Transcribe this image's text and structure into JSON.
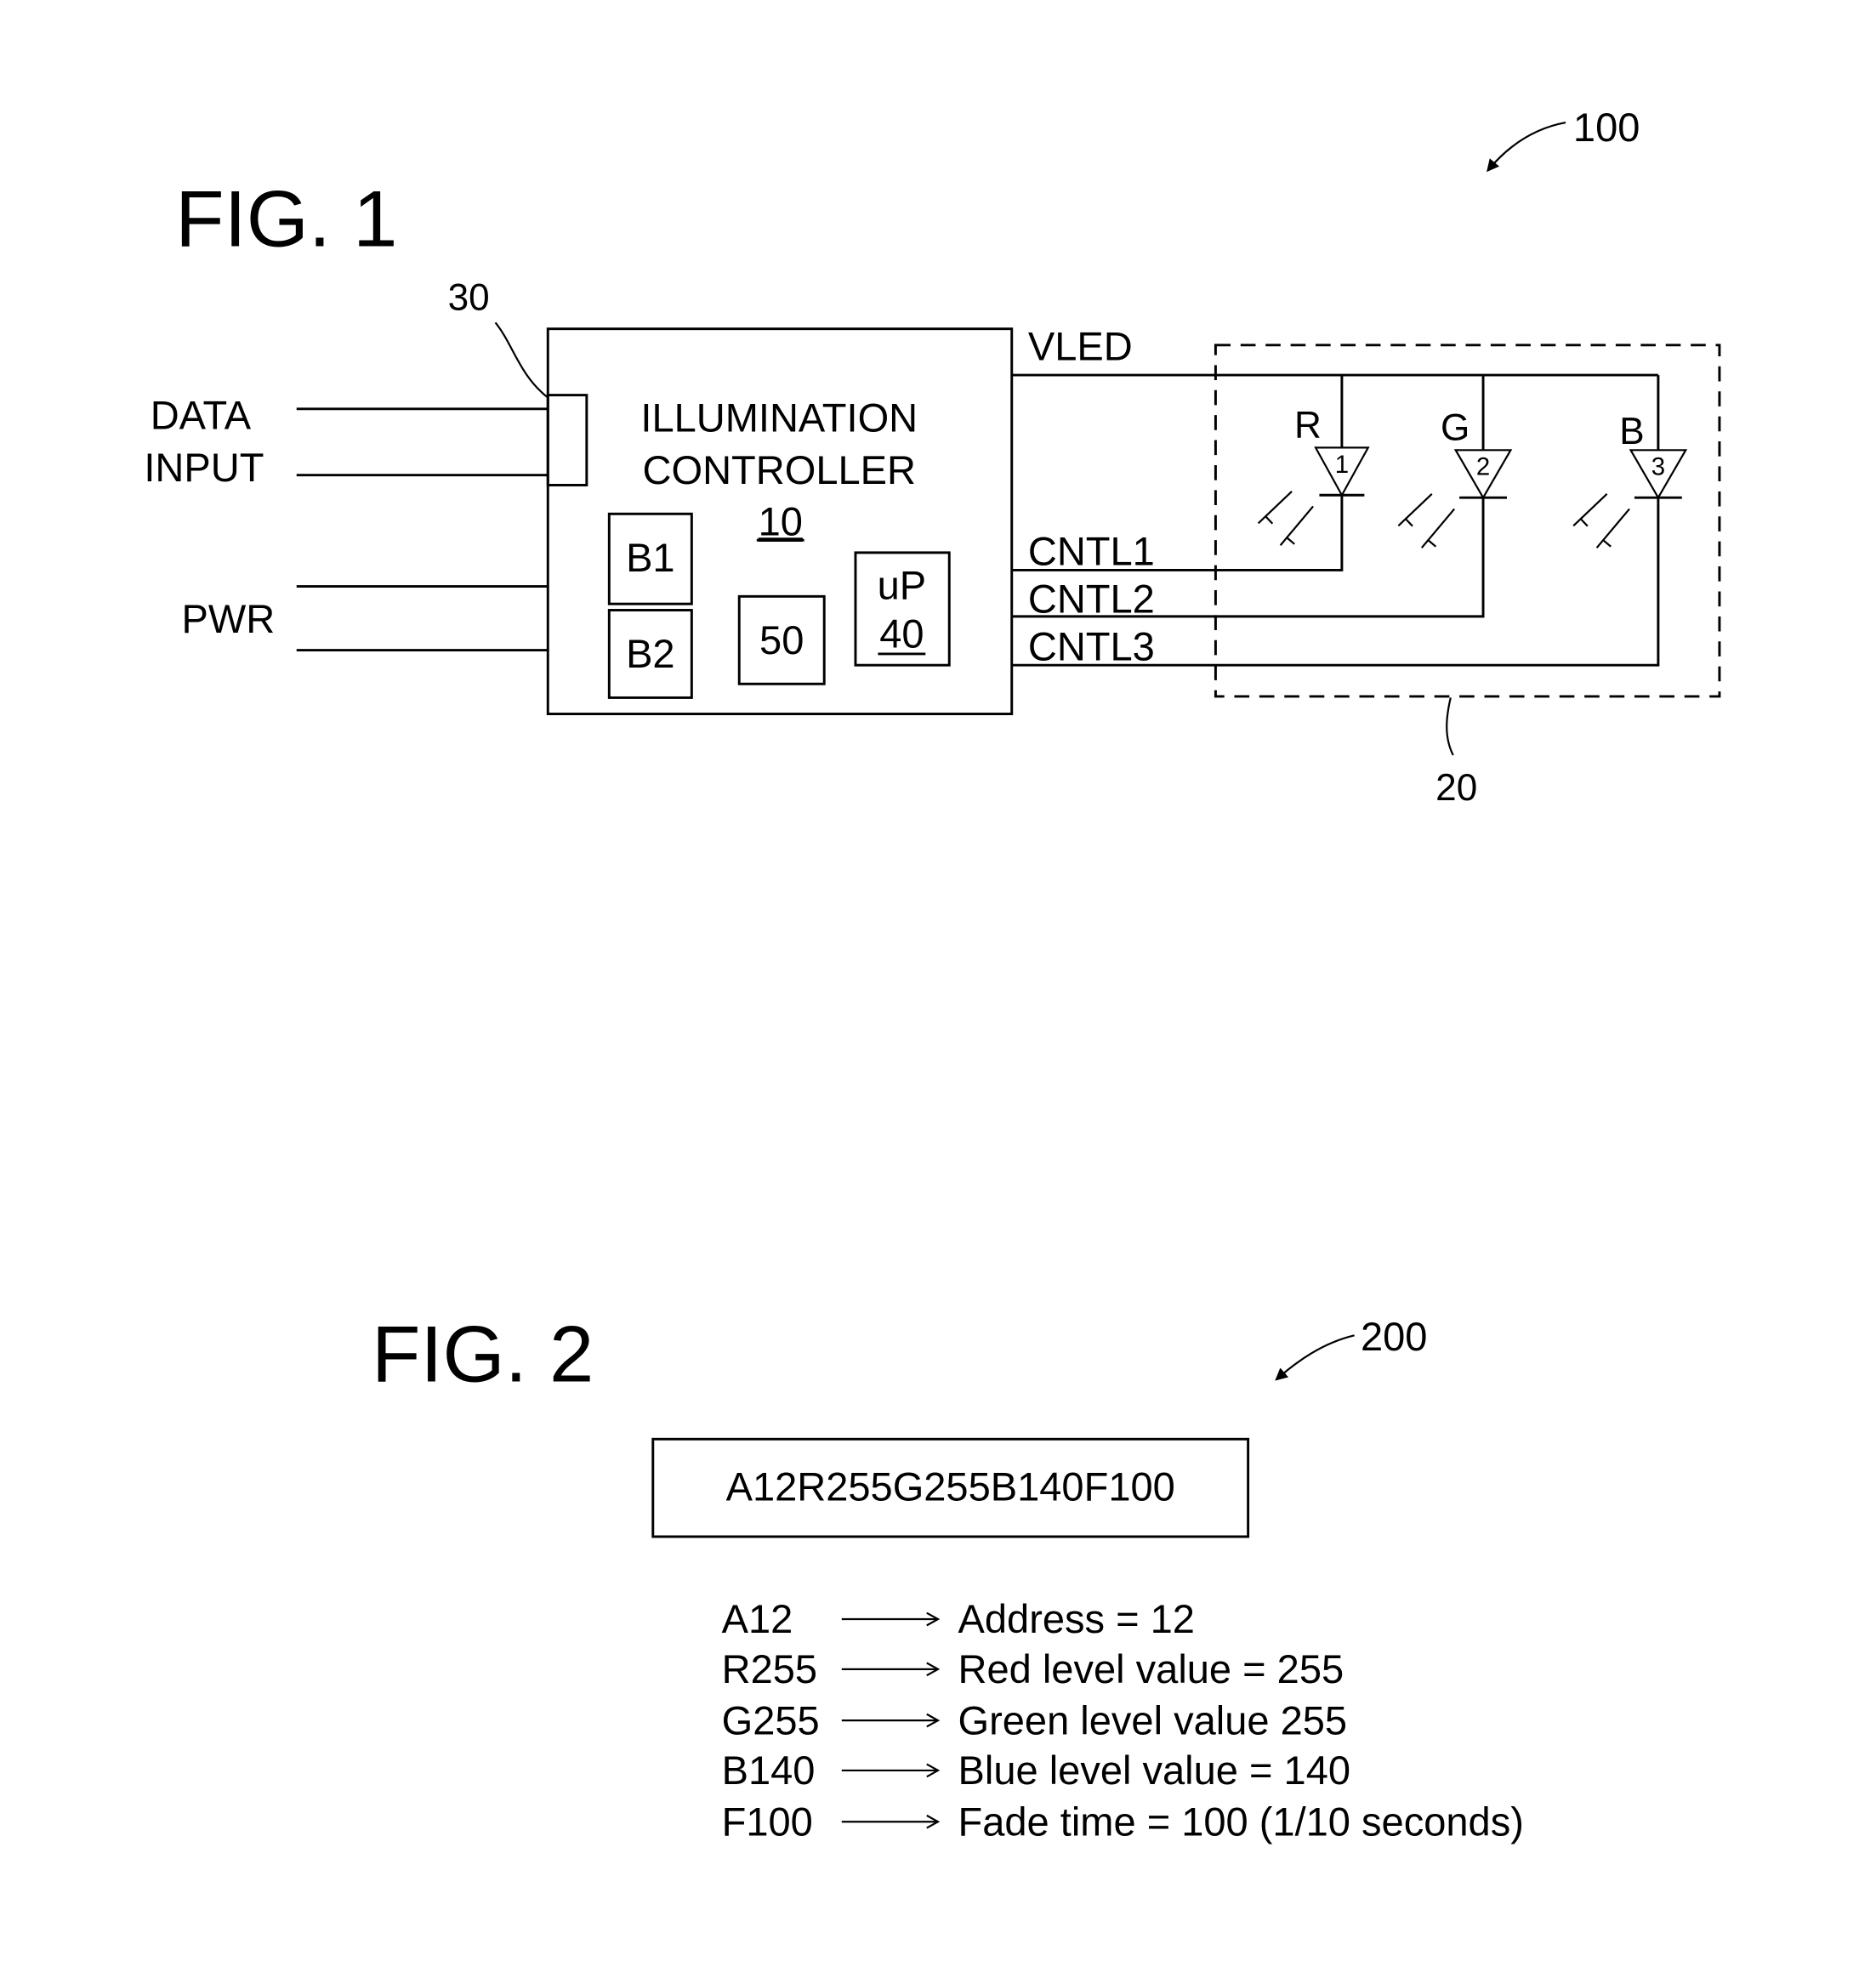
{
  "fig1": {
    "title": "FIG. 1",
    "ref_system": "100",
    "ref_connector": "30",
    "ref_led_group": "20",
    "inputs": {
      "data_line1": "DATA",
      "data_line2": "INPUT",
      "power": "PWR"
    },
    "controller": {
      "line1": "ILLUMINATION",
      "line2": "CONTROLLER",
      "ref": "10",
      "blocks": {
        "b1": "B1",
        "b2": "B2",
        "block50": "50",
        "up_label": "uP",
        "up_ref": "40"
      }
    },
    "outputs": {
      "vled": "VLED",
      "cntl1": "CNTL1",
      "cntl2": "CNTL2",
      "cntl3": "CNTL3"
    },
    "leds": [
      {
        "color": "R",
        "number": "1"
      },
      {
        "color": "G",
        "number": "2"
      },
      {
        "color": "B",
        "number": "3"
      }
    ]
  },
  "fig2": {
    "title": "FIG. 2",
    "ref": "200",
    "command_string": "A12R255G255B140F100",
    "legend": [
      {
        "code": "A12",
        "meaning": "Address = 12"
      },
      {
        "code": "R255",
        "meaning": "Red level value = 255"
      },
      {
        "code": "G255",
        "meaning": "Green level value 255"
      },
      {
        "code": "B140",
        "meaning": "Blue level value = 140"
      },
      {
        "code": "F100",
        "meaning": "Fade time = 100 (1/10 seconds)"
      }
    ]
  }
}
